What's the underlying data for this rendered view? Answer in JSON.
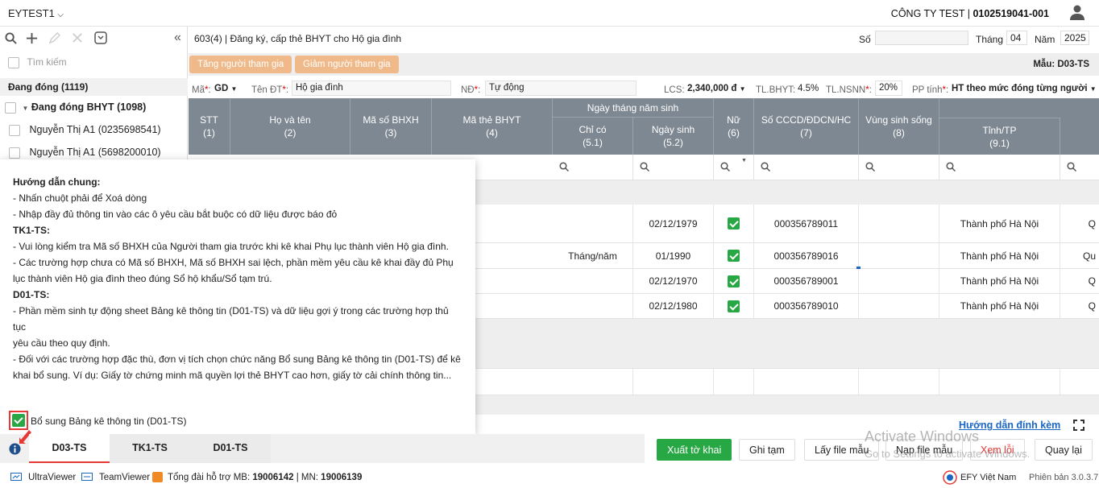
{
  "header": {
    "account": "EYTEST1",
    "company_name": "CÔNG TY TEST | ",
    "company_code": "0102519041-001"
  },
  "sidebar": {
    "search_placeholder": "Tìm kiếm",
    "group_label": "Đang đóng (1119)",
    "tree": [
      {
        "label": "Đang đóng BHYT (1098)"
      },
      {
        "label": "Nguyễn Thị A1 (0235698541)"
      },
      {
        "label": "Nguyễn Thị A1 (5698200010)"
      }
    ]
  },
  "form": {
    "title_code": "603(4)",
    "title_text": " | Đăng ký, cấp thẻ BHYT cho Hộ gia đình",
    "so_label": "Số",
    "so_value": "",
    "thang_label": "Tháng",
    "thang_value": "04",
    "nam_label": "Năm",
    "nam_value": "2025",
    "add_btn": "Tăng người tham gia",
    "remove_btn": "Giảm người tham gia",
    "mau": "Mẫu: D03-TS"
  },
  "info": {
    "ma_label": "Mã",
    "ma_value": "GD",
    "tendt_label": "Tên ĐT",
    "tendt_value": "Hộ gia đình",
    "nd_label": "NĐ",
    "nd_value": "Tự động",
    "lcs_label": "LCS:",
    "lcs_value": "2,340,000 đ",
    "tlbhyt_label": "TL.BHYT:",
    "tlbhyt_value": "4.5%",
    "tlnsnn_label": "TL.NSNN",
    "tlnsnn_value": "20%",
    "pp_label": "PP tính",
    "pp_value": "HT theo mức đóng từng người"
  },
  "table": {
    "group_header": "Ngày tháng năm sinh",
    "columns": [
      {
        "title": "STT",
        "sub": "(1)"
      },
      {
        "title": "Họ và tên",
        "sub": "(2)"
      },
      {
        "title": "Mã số BHXH",
        "sub": "(3)"
      },
      {
        "title": "Mã thẻ BHYT",
        "sub": "(4)"
      },
      {
        "title": "Chỉ có",
        "sub": "(5.1)"
      },
      {
        "title": "Ngày sinh",
        "sub": "(5.2)"
      },
      {
        "title": "Nữ",
        "sub": "(6)"
      },
      {
        "title": "Số CCCD/ĐDCN/HC",
        "sub": "(7)"
      },
      {
        "title": "Vùng sinh sống",
        "sub": "(8)"
      },
      {
        "title": "Tỉnh/TP",
        "sub": "(9.1)"
      }
    ],
    "rows": [
      {
        "chi_co": "",
        "ngay_sinh": "02/12/1979",
        "nu": true,
        "cccd": "000356789011",
        "tinh": "Thành phố Hà Nội",
        "more": "Q"
      },
      {
        "chi_co": "Tháng/năm",
        "ngay_sinh": "01/1990",
        "nu": true,
        "cccd": "000356789016",
        "tinh": "Thành phố Hà Nội",
        "more": "Qu"
      },
      {
        "chi_co": "",
        "ngay_sinh": "02/12/1970",
        "nu": true,
        "cccd": "000356789001",
        "tinh": "Thành phố Hà Nội",
        "more": "Q"
      },
      {
        "chi_co": "",
        "ngay_sinh": "02/12/1980",
        "nu": true,
        "cccd": "000356789010",
        "tinh": "Thành phố Hà Nội",
        "more": "Q"
      }
    ]
  },
  "popup": {
    "heading": "Hướng dẫn chung:",
    "lines1": [
      "- Nhấn chuột phải để Xoá dòng",
      "- Nhập đầy đủ thông tin vào các ô yêu cầu bắt buộc có dữ liệu được báo đỏ"
    ],
    "tk1_heading": "TK1-TS:",
    "tk1_lines": [
      "- Vui lòng kiểm tra Mã số BHXH của Người tham gia trước khi kê khai Phụ lục thành viên Hộ gia đình.",
      "- Các trường hợp chưa có Mã số BHXH, Mã số BHXH sai lệch, phần mềm yêu cầu kê khai đầy đủ Phụ",
      "lục thành viên Hộ gia đình theo đúng Sổ hộ khẩu/Sổ tạm trú."
    ],
    "d01_heading": "D01-TS:",
    "d01_lines": [
      "- Phần mềm sinh tự động sheet Bảng kê thông tin (D01-TS) và dữ liệu gợi ý trong các trường hợp thủ tục",
      "yêu cầu theo quy định.",
      "- Đối với các trường hợp đặc thù, đơn vị tích chọn chức năng Bổ sung Bảng kê thông tin (D01-TS) để kê",
      "khai bổ sung. Ví dụ: Giấy tờ chứng minh mã quyền lợi thẻ BHYT cao hơn, giấy tờ cải chính thông tin..."
    ],
    "checkbox_label": "Bổ sung Bảng kê thông tin (D01-TS)"
  },
  "guide_link": "Hướng dẫn đính kèm",
  "tabs": [
    "D03-TS",
    "TK1-TS",
    "D01-TS"
  ],
  "actions": {
    "export": "Xuất tờ khai",
    "save": "Ghi tạm",
    "get_template": "Lấy file mẫu",
    "load_template": "Nạp file mẫu",
    "view_errors": "Xem lỗi",
    "back": "Quay lại"
  },
  "watermark": {
    "line1": "Activate Windows",
    "line2": "Go to Settings to activate Windows."
  },
  "footer": {
    "ultraviewer": "UltraViewer",
    "teamviewer": "TeamViewer",
    "hotline_prefix": "Tổng đài hỗ trợ MB: ",
    "hotline_mb": "19006142",
    "hotline_mid": " | MN: ",
    "hotline_mn": "19006139",
    "efy": "EFY Việt Nam",
    "version": "Phiên bản 3.0.3.7"
  },
  "colors": {
    "header_bg": "#7e8892",
    "accent_green": "#28a745",
    "orange_btn": "#f0b98a",
    "red": "#e53935",
    "link_blue": "#1a66c4"
  }
}
